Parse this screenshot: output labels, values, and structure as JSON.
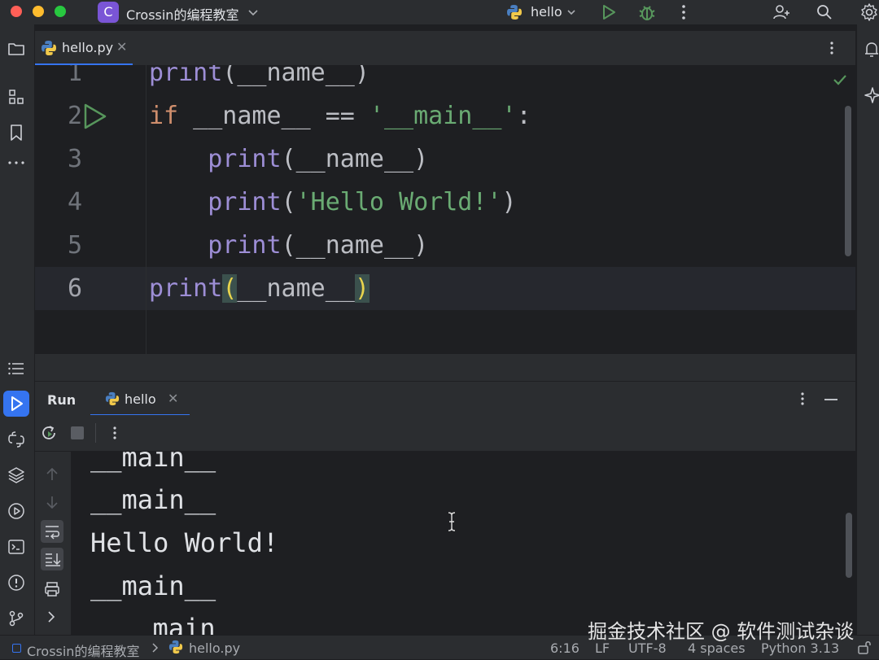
{
  "titlebar": {
    "project_initial": "C",
    "project_name": "Crossin的编程教室",
    "run_config": "hello"
  },
  "editor": {
    "tab_label": "hello.py",
    "line_numbers": [
      "1",
      "2",
      "3",
      "4",
      "5",
      "6"
    ],
    "lines": [
      {
        "indent": "",
        "tokens": [
          {
            "t": "print",
            "c": "fn"
          },
          {
            "t": "(__name__)",
            "c": ""
          }
        ]
      },
      {
        "indent": "",
        "tokens": [
          {
            "t": "if",
            "c": "kw"
          },
          {
            "t": " __name__ == ",
            "c": ""
          },
          {
            "t": "'__main__'",
            "c": "str"
          },
          {
            "t": ":",
            "c": ""
          }
        ]
      },
      {
        "indent": "    ",
        "tokens": [
          {
            "t": "print",
            "c": "fn"
          },
          {
            "t": "(__name__)",
            "c": ""
          }
        ]
      },
      {
        "indent": "    ",
        "tokens": [
          {
            "t": "print",
            "c": "fn"
          },
          {
            "t": "(",
            "c": ""
          },
          {
            "t": "'Hello World!'",
            "c": "str"
          },
          {
            "t": ")",
            "c": ""
          }
        ]
      },
      {
        "indent": "    ",
        "tokens": [
          {
            "t": "print",
            "c": "fn"
          },
          {
            "t": "(__name__)",
            "c": ""
          }
        ]
      },
      {
        "indent": "",
        "tokens": [
          {
            "t": "print",
            "c": "fn"
          },
          {
            "t": "(",
            "c": "brace-hl"
          },
          {
            "t": "__name__",
            "c": ""
          },
          {
            "t": ")",
            "c": "brace-hl"
          }
        ]
      }
    ]
  },
  "run_panel": {
    "title": "Run",
    "tab_label": "hello",
    "output": [
      "__main__",
      "__main__",
      "Hello World!",
      "__main__",
      "__main__"
    ]
  },
  "statusbar": {
    "breadcrumb_project": "Crossin的编程教室",
    "breadcrumb_file": "hello.py",
    "cursor_position": "6:16",
    "line_separator": "LF",
    "encoding": "UTF-8",
    "indent": "4 spaces",
    "interpreter": "Python 3.13"
  },
  "watermark": "掘金技术社区 @ 软件测试杂谈",
  "colors": {
    "accent": "#3574f0",
    "run_green": "#57965c",
    "project_badge": "#7a55d6",
    "keyword": "#cf8e6d",
    "function": "#9d8ed6",
    "string": "#6aab73"
  }
}
